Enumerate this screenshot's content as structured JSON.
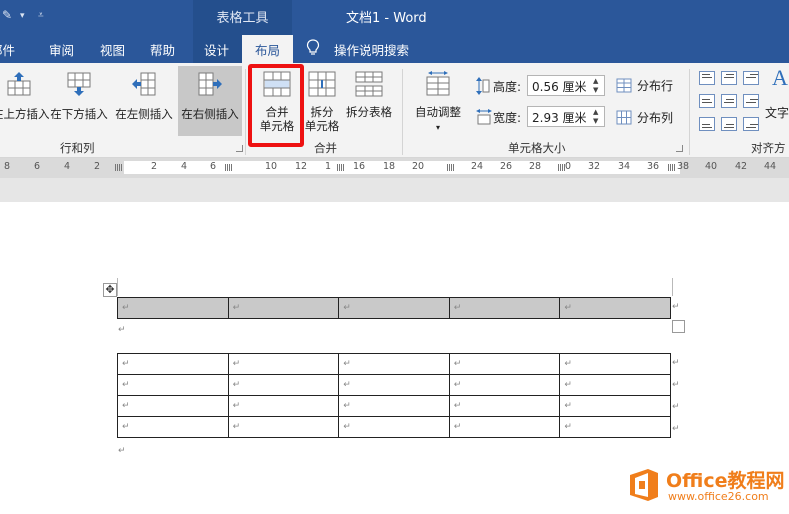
{
  "title_bar": {
    "context_title": "表格工具",
    "document_title": "文档1  -  Word"
  },
  "tabs": {
    "mailings": "邮件",
    "review": "审阅",
    "view": "视图",
    "help": "帮助",
    "design": "设计",
    "layout": "布局",
    "tell_me": "操作说明搜索"
  },
  "ribbon": {
    "rows_cols": {
      "insert_above": "在上方插入",
      "insert_below": "在下方插入",
      "insert_left": "在左侧插入",
      "insert_right": "在右侧插入",
      "group_label": "行和列"
    },
    "merge": {
      "merge_cells_line1": "合并",
      "merge_cells_line2": "单元格",
      "split_cells_line1": "拆分",
      "split_cells_line2": "单元格",
      "split_table": "拆分表格",
      "group_label": "合并"
    },
    "cell_size": {
      "autofit": "自动调整",
      "height_label": "高度:",
      "height_value": "0.56 厘米",
      "width_label": "宽度:",
      "width_value": "2.93 厘米",
      "distribute_rows": "分布行",
      "distribute_cols": "分布列",
      "group_label": "单元格大小"
    },
    "alignment": {
      "text_direction": "文字",
      "group_label": "对齐方"
    }
  },
  "ruler": {
    "left_ticks": [
      "8",
      "6",
      "4",
      "2"
    ],
    "right_ticks": [
      "2",
      "4",
      "6",
      "10",
      "12",
      "1",
      "16",
      "18",
      "20",
      "24",
      "26",
      "28",
      "0",
      "32",
      "34",
      "36",
      "38",
      "40",
      "42",
      "44"
    ]
  },
  "document": {
    "move_handle_symbol": "✥",
    "cell_mark": "↵",
    "para_mark": "↵",
    "top_table": {
      "rows": 1,
      "cols": 5
    },
    "bottom_table": {
      "rows": 4,
      "cols": 5
    }
  },
  "watermark": {
    "line1": "Office教程网",
    "line2": "www.office26.com"
  },
  "colors": {
    "title_bar": "#2b579a",
    "ribbon_bg": "#f3f3f3",
    "highlight": "#ee1111",
    "watermark": "#f07e1b"
  }
}
